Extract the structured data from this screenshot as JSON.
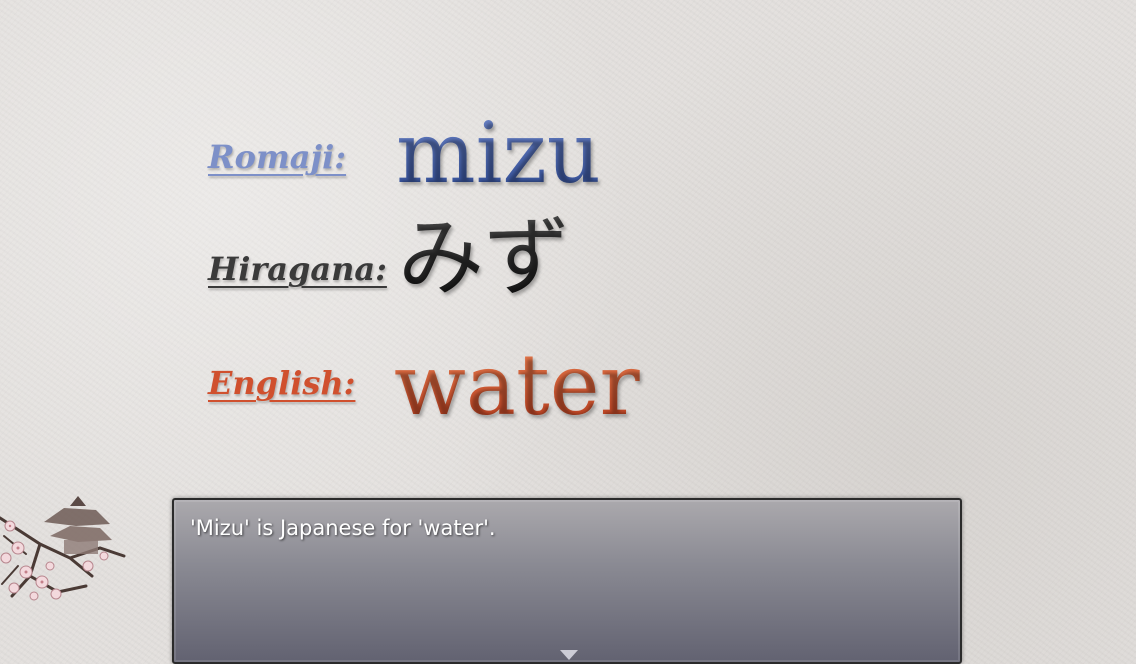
{
  "vocab": {
    "romaji": {
      "label": "Romaji:",
      "value": "mizu"
    },
    "hiragana": {
      "label": "Hiragana:",
      "value": "みず"
    },
    "english": {
      "label": "English:",
      "value": "water"
    }
  },
  "message": {
    "text": "'Mizu' is Japanese for 'water'."
  },
  "icons": {
    "decoration": "cherry-blossom-pagoda-icon",
    "continue": "triangle-down-icon"
  },
  "colors": {
    "romaji": "#3f5aa3",
    "hiragana": "#1f1f1f",
    "english": "#c84a25",
    "message_window": "#7a7a84"
  }
}
